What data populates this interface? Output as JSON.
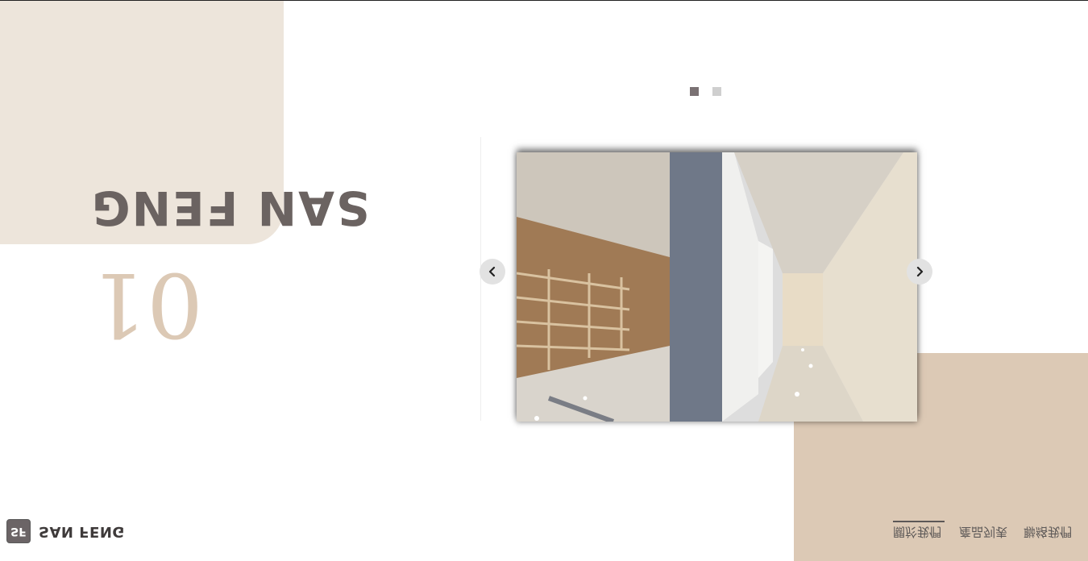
{
  "hero": {
    "title": "SAN FENG",
    "number": "01"
  },
  "slider": {
    "active_dot": 1,
    "dots": 2,
    "prev_icon": "chevron-left-icon",
    "next_icon": "chevron-right-icon",
    "image_alt": "showroom-corridor-photo"
  },
  "footer": {
    "logo_badge": "SF",
    "logo_text": "SAN FENG"
  },
  "nav": {
    "items": [
      "關於我們",
      "產品列表",
      "聯絡我們"
    ]
  },
  "colors": {
    "beige_light": "#ede5db",
    "beige_dark": "#dcc9b5",
    "text_dark": "#6b6361"
  }
}
